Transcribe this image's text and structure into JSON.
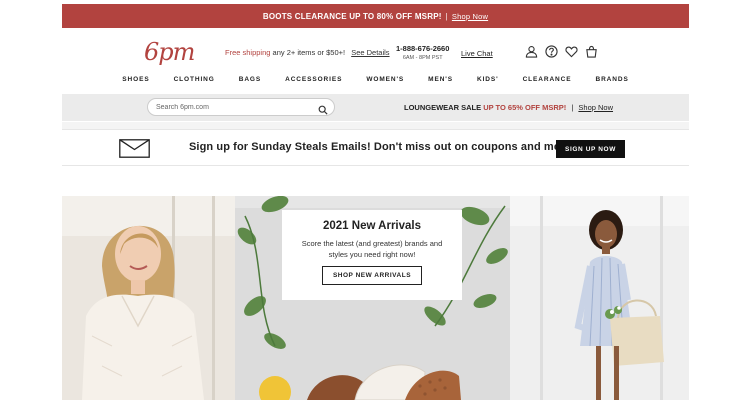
{
  "promo": {
    "text": "BOOTS CLEARANCE UP TO 80% OFF MSRP!",
    "separator": "|",
    "link": "Shop Now"
  },
  "header": {
    "logo": "6pm",
    "shipping_prefix": "Free shipping",
    "shipping_suffix": "any 2+ items or $50+!",
    "see_details": "See Details",
    "phone": "1-888-676-2660",
    "hours": "6AM - 8PM PST",
    "live_chat": "Live Chat",
    "icons": [
      "account-icon",
      "help-icon",
      "heart-icon",
      "cart-icon"
    ]
  },
  "nav": {
    "items": [
      "SHOES",
      "CLOTHING",
      "BAGS",
      "ACCESSORIES",
      "WOMEN'S",
      "MEN'S",
      "KIDS'",
      "CLEARANCE",
      "BRANDS"
    ]
  },
  "search": {
    "placeholder": "Search 6pm.com"
  },
  "loungewear": {
    "prefix": "LOUNGEWEAR SALE",
    "highlight": "UP TO 65% OFF MSRP!",
    "separator": "|",
    "link": "Shop Now"
  },
  "signup": {
    "text": "Sign up for Sunday Steals Emails! Don't miss out on coupons and more.",
    "button": "SIGN UP NOW"
  },
  "hero": {
    "title": "2021 New Arrivals",
    "body": "Score the latest (and greatest) brands and styles you need right now!",
    "button": "SHOP NEW ARRIVALS"
  },
  "colors": {
    "brand": "#b2433f",
    "button": "#111111",
    "search_bg": "#ebebeb"
  }
}
